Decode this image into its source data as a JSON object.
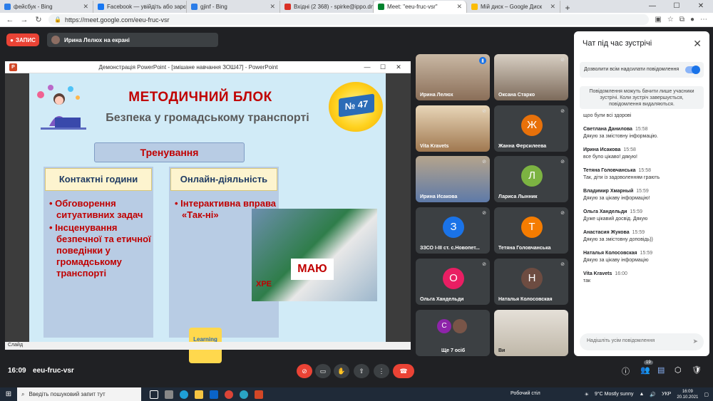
{
  "browser": {
    "tabs": [
      {
        "title": "фейсбук - Bing",
        "color": "#2b7de9"
      },
      {
        "title": "Facebook — увійдіть або зарєє",
        "color": "#1877f2"
      },
      {
        "title": "gjinf - Bing",
        "color": "#2b7de9"
      },
      {
        "title": "Вхідні (2 368) - spirke@ippo.dn",
        "color": "#d93025"
      },
      {
        "title": "Meet: \"eeu-fruc-vsr\"",
        "color": "#00832d"
      },
      {
        "title": "Мій диск – Google Диск",
        "color": "#fbbc04"
      }
    ],
    "new_tab": "+",
    "url": "https://meet.google.com/eeu-fruc-vsr"
  },
  "meet": {
    "record_label": "ЗАПИС",
    "presenter_label": "Ирина Лелюх на екрані",
    "ppt_window_title": "Демонстрація PowerPoint - [змішане навчання ЗОШ47] - PowerPoint",
    "status_text": "Слайд",
    "slide": {
      "title": "МЕТОДИЧНИЙ БЛОК",
      "subtitle": "Безпека у громадському транспорті",
      "badge": "№ 47",
      "training": "Тренування",
      "col1_head": "Контактні години",
      "col1_items": [
        "Обговорення ситуативних задач",
        "Інсценування безпечної та етичної поведінки у громадському транспорті"
      ],
      "col2_head": "Онлайн-діяльність",
      "col2_items": [
        "Інтерактивна вправа «Так-ні»"
      ],
      "learning_apps": "Learning Apps.org",
      "photo_text": "МАЮ",
      "photo_text2": "ХРЕ"
    },
    "participants": [
      {
        "name": "Ирина Лелюх",
        "initial": "",
        "color": ""
      },
      {
        "name": "Оксана Старко",
        "initial": "",
        "color": ""
      },
      {
        "name": "Vita Kravets",
        "initial": "",
        "color": ""
      },
      {
        "name": "Жанна Ферсилеева",
        "initial": "Ж",
        "color": "#e8710a"
      },
      {
        "name": "Ирина Исакова",
        "initial": "",
        "color": ""
      },
      {
        "name": "Лариса Лынник",
        "initial": "Л",
        "color": "#7cb342"
      },
      {
        "name": "ЗЗСО І-ІІІ ст. с.Новопет...",
        "initial": "З",
        "color": "#1a73e8"
      },
      {
        "name": "Тетяна Головчанська",
        "initial": "Т",
        "color": "#f57c00"
      },
      {
        "name": "Ольга Хандельди",
        "initial": "О",
        "color": "#e91e63"
      },
      {
        "name": "Наталья Колосовская",
        "initial": "Н",
        "color": "#6d4c41"
      },
      {
        "name": "Ще 7 осіб",
        "initial": "С",
        "color": "#8e24aa"
      },
      {
        "name": "Ви",
        "initial": "",
        "color": ""
      }
    ],
    "chat": {
      "title": "Чат під час зустрічі",
      "allow_label": "Дозволити всім надсилати повідомлення",
      "note": "Повідомлення можуть бачити лише учасники зустрічі. Коли зустріч завершується, повідомлення видаляються.",
      "messages": [
        {
          "author": "",
          "time": "",
          "text": "щоо були всі здорові"
        },
        {
          "author": "Светлана Данилова",
          "time": "15:58",
          "text": "Дякую за змістовну інформацію."
        },
        {
          "author": "Ирина Исакова",
          "time": "15:58",
          "text": "все було цікаво! дякую!"
        },
        {
          "author": "Тетяна Головчанська",
          "time": "15:58",
          "text": "Так, діти із задоволенням грають"
        },
        {
          "author": "Владимир Хмарный",
          "time": "15:59",
          "text": "Дякую за цікаву інформацію!"
        },
        {
          "author": "Ольга Хандельди",
          "time": "15:59",
          "text": "Дуже цікавий досвід. Дякую"
        },
        {
          "author": "Анастасия Жукова",
          "time": "15:59",
          "text": "Дякую за змістовну доповідь))"
        },
        {
          "author": "Наталья Колосовская",
          "time": "15:59",
          "text": "Дякую за цікаву інформацію"
        },
        {
          "author": "Vita Kravets",
          "time": "16:00",
          "text": "так"
        }
      ],
      "input_placeholder": "Надішліть усім повідомлення"
    },
    "bottom": {
      "time": "16:09",
      "code": "eeu-fruc-vsr",
      "participant_count": "19"
    }
  },
  "taskbar": {
    "search_placeholder": "Введіть пошуковий запит тут",
    "desktop_label": "Робочий стіл",
    "weather": "9°C Mostly sunny",
    "lang": "УКР",
    "time": "16:09",
    "date": "20.10.2021"
  }
}
